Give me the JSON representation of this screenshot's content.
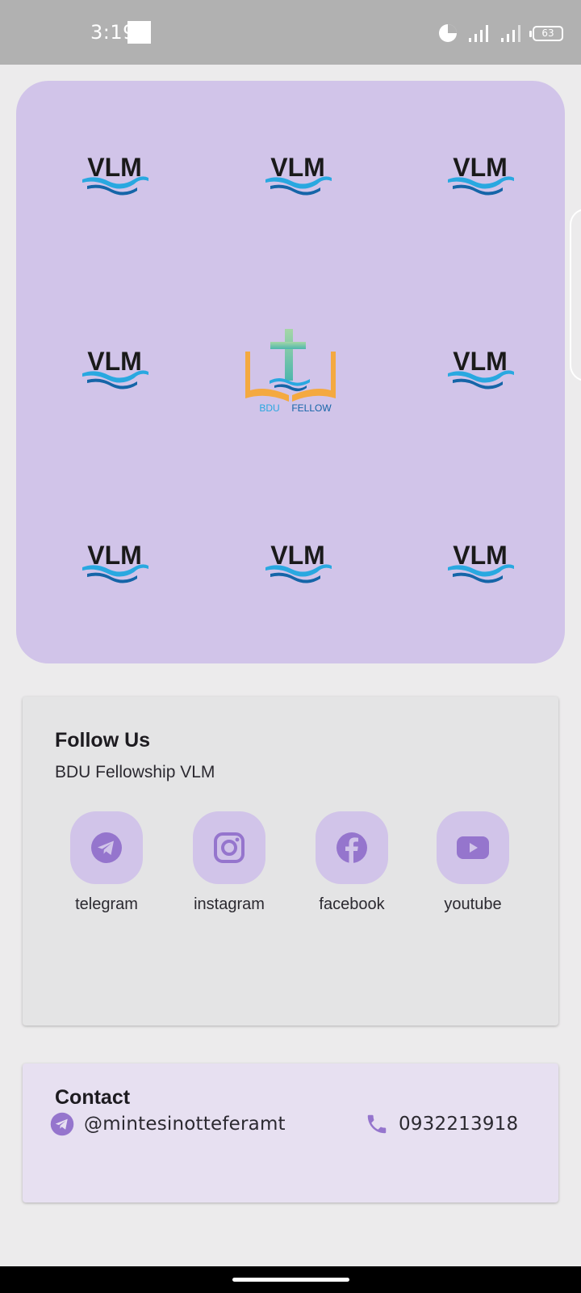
{
  "status_bar": {
    "time": "3:19",
    "battery_level": "63",
    "icons": [
      "data-saver-icon",
      "signal-icon",
      "signal-icon",
      "battery-icon"
    ]
  },
  "hero": {
    "logo_text": "VLM",
    "center_logo": {
      "left": "BDU",
      "right": "FELLOW"
    }
  },
  "follow": {
    "title": "Follow Us",
    "subtitle": "BDU Fellowship VLM",
    "links": [
      {
        "label": "telegram",
        "icon": "telegram-icon"
      },
      {
        "label": "instagram",
        "icon": "instagram-icon"
      },
      {
        "label": "facebook",
        "icon": "facebook-icon"
      },
      {
        "label": "youtube",
        "icon": "youtube-icon"
      }
    ]
  },
  "contact": {
    "title": "Contact",
    "telegram": "@mintesinotteferamt",
    "phone": "0932213918"
  },
  "colors": {
    "accent": "#9575cd",
    "hero_bg": "#d1c4e9",
    "icon_bubble": "#d1c4e9",
    "contact_bg": "#e7e0f1"
  }
}
